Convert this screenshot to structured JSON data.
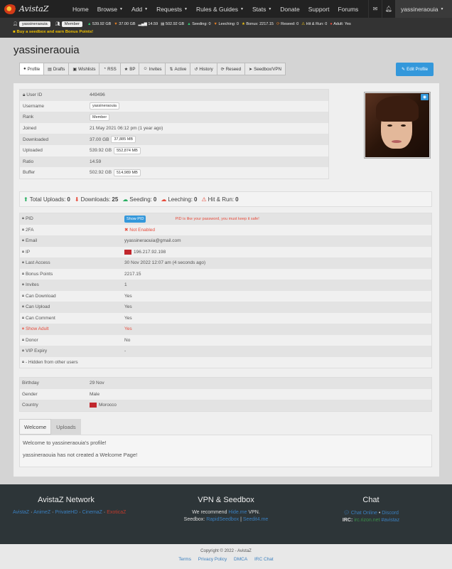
{
  "nav": {
    "brand": "AvistaZ",
    "items": [
      {
        "label": "Home",
        "dropdown": false
      },
      {
        "label": "Browse",
        "dropdown": true
      },
      {
        "label": "Add",
        "dropdown": true
      },
      {
        "label": "Requests",
        "dropdown": true
      },
      {
        "label": "Rules & Guides",
        "dropdown": true
      },
      {
        "label": "Stats",
        "dropdown": true
      },
      {
        "label": "Donate",
        "dropdown": false
      },
      {
        "label": "Support",
        "dropdown": false
      },
      {
        "label": "Forums",
        "dropdown": false
      }
    ],
    "user": "yassineraouia",
    "icons": [
      "envelope-icon",
      "bell-icon"
    ]
  },
  "status": {
    "username": "yassineraouia",
    "rank": "Member",
    "uploaded": "539.92 GB",
    "downloaded": "37.00 GB",
    "ratio": "14.59",
    "buffer": "502.92 GB",
    "seeding_label": "Seeding:",
    "seeding": "0",
    "leeching_label": "Leeching:",
    "leeching": "0",
    "bonus_label": "Bonus:",
    "bonus": "2217.15",
    "reseed_label": "Reseed:",
    "reseed": "0",
    "hnr_label": "Hit & Run:",
    "hnr": "0",
    "adult_label": "Adult:",
    "adult": "Yes",
    "promo": "Buy a seedbox and earn Bonus Points!"
  },
  "page_title": "yassineraouia",
  "tabs": [
    {
      "label": "Profile",
      "icon": "●"
    },
    {
      "label": "Drafts",
      "icon": "▤"
    },
    {
      "label": "Wishlists",
      "icon": "▣"
    },
    {
      "label": "RSS",
      "icon": "◔"
    },
    {
      "label": "BP",
      "icon": "★"
    },
    {
      "label": "Invites",
      "icon": "☺"
    },
    {
      "label": "Active",
      "icon": "⇅"
    },
    {
      "label": "History",
      "icon": "↺"
    },
    {
      "label": "Reseed",
      "icon": "⟳"
    },
    {
      "label": "Seedbox/VPN",
      "icon": "➤"
    }
  ],
  "edit_profile": "Edit Profile",
  "info": {
    "user_id_label": "User ID",
    "user_id": "449496",
    "username_label": "Username",
    "username": "yassineraouia",
    "rank_label": "Rank",
    "rank": "Member",
    "joined_label": "Joined",
    "joined": "21 May 2021 06:12 pm (1 year ago)",
    "downloaded_label": "Downloaded",
    "downloaded": "37.00 GB",
    "downloaded_mb": "37,885 MB",
    "uploaded_label": "Uploaded",
    "uploaded": "539.92 GB",
    "uploaded_mb": "552,874 MB",
    "ratio_label": "Ratio",
    "ratio": "14.59",
    "buffer_label": "Buffer",
    "buffer": "502.92 GB",
    "buffer_mb": "514,989 MB"
  },
  "torrent_stats": {
    "uploads_label": "Total Uploads:",
    "uploads": "0",
    "downloads_label": "Downloads:",
    "downloads": "25",
    "seeding_label": "Seeding:",
    "seeding": "0",
    "leeching_label": "Leeching:",
    "leeching": "0",
    "hnr_label": "Hit & Run:",
    "hnr": "0"
  },
  "perms": {
    "pid_label": "PID",
    "show_pid": "Show PID",
    "pid_note": "PID is like your password, you must keep it safe!",
    "twofa_label": "2FA",
    "twofa": "Not Enabled",
    "email_label": "Email",
    "email": "yyassineraouia@gmail.com",
    "ip_label": "IP",
    "ip": "196.217.92.198",
    "last_access_label": "Last Access",
    "last_access": "30 Nov 2022 12:07 am (4 seconds ago)",
    "bonus_label": "Bonus Points",
    "bonus": "2217.15",
    "invites_label": "Invites",
    "invites": "1",
    "can_download_label": "Can Download",
    "can_download": "Yes",
    "can_upload_label": "Can Upload",
    "can_upload": "Yes",
    "can_comment_label": "Can Comment",
    "can_comment": "Yes",
    "show_adult_label": "Show Adult",
    "show_adult": "Yes",
    "donor_label": "Donor",
    "donor": "No",
    "vip_label": "VIP Expiry",
    "vip": "-",
    "hidden_label": "- Hidden from other users"
  },
  "profile": {
    "birthday_label": "Birthday",
    "birthday": "29 Nov",
    "gender_label": "Gender",
    "gender": "Male",
    "country_label": "Country",
    "country": "Morocco"
  },
  "welcome": {
    "tab_welcome": "Welcome",
    "tab_uploads": "Uploads",
    "line1": "Welcome to yassineraouia's profile!",
    "line2": "yassineraouia has not created a Welcome Page!"
  },
  "footer": {
    "network_title": "AvistaZ Network",
    "network_links": [
      "AvistaZ",
      "AnimeZ",
      "PrivateHD",
      "CinemaZ",
      "ExoticaZ"
    ],
    "vpn_title": "VPN & Seedbox",
    "vpn_recommend": "We recommend",
    "vpn_link": "Hide.me",
    "vpn_suffix": "VPN.",
    "seedbox_label": "Seedbox:",
    "seedbox_link1": "RapidSeedbox",
    "seedbox_sep": "|",
    "seedbox_link2": "Seedit4.me",
    "chat_title": "Chat",
    "chat_online": "Chat Online",
    "chat_sep": "•",
    "discord": "Discord",
    "irc_label": "IRC:",
    "irc_server": "irc.rizon.net",
    "irc_channel": "#avistaz",
    "copyright": "Copyright © 2022 - AvistaZ",
    "bottom_links": [
      "Terms",
      "Privacy Policy",
      "DMCA",
      "IRC Chat"
    ]
  },
  "colors": {
    "accent": "#3498db",
    "danger": "#e74c3c",
    "navbar": "#222222",
    "footer": "#2d3538"
  }
}
